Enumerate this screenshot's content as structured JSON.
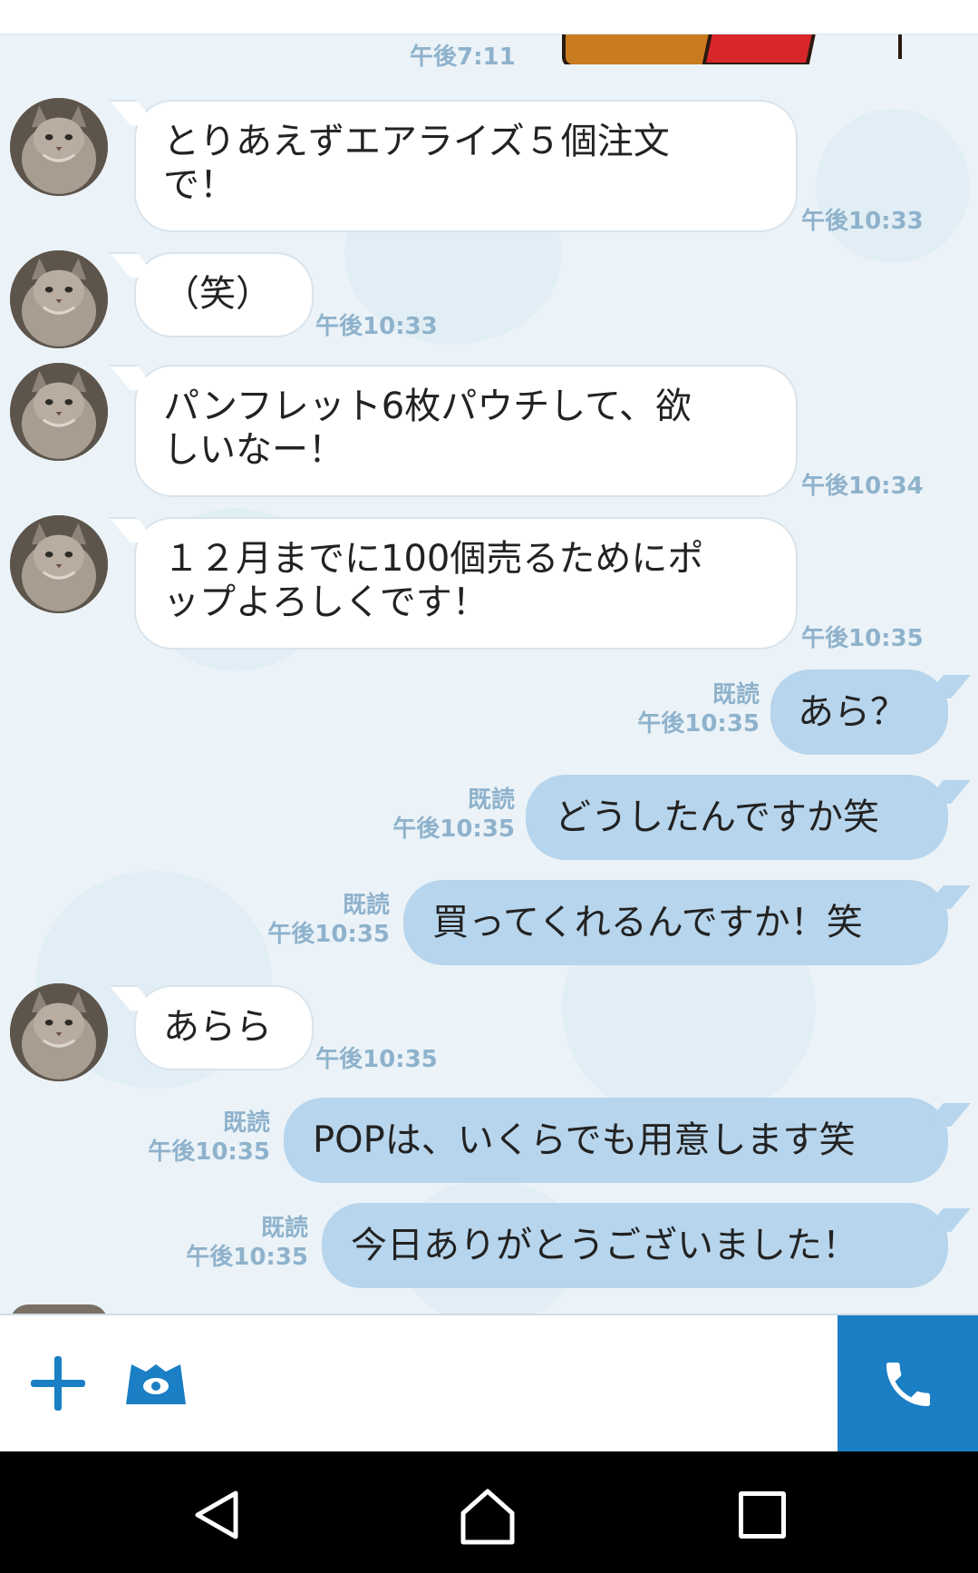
{
  "colors": {
    "accent": "#1a7fc4",
    "bubble_out": "#b7d5ec",
    "bubble_in": "#ffffff",
    "meta_text": "#8fb2cc"
  },
  "chat": {
    "top_time": "午後7:11",
    "messages": [
      {
        "dir": "in",
        "text_lines": [
          "とりあえずエアライズ５個注文",
          "で！"
        ],
        "time": "午後10:33"
      },
      {
        "dir": "in",
        "text_lines": [
          "（笑）"
        ],
        "time": "午後10:33"
      },
      {
        "dir": "in",
        "text_lines": [
          "パンフレット6枚パウチして、欲",
          "しいなー！"
        ],
        "time": "午後10:34"
      },
      {
        "dir": "in",
        "text_lines": [
          "１２月までに100個売るためにポ",
          "ップよろしくです！"
        ],
        "time": "午後10:35"
      },
      {
        "dir": "out",
        "text": "あら？",
        "read": "既読",
        "time": "午後10:35"
      },
      {
        "dir": "out",
        "text": "どうしたんですか笑",
        "read": "既読",
        "time": "午後10:35"
      },
      {
        "dir": "out",
        "text": "買ってくれるんですか！笑",
        "read": "既読",
        "time": "午後10:35"
      },
      {
        "dir": "in",
        "text_lines": [
          "あらら"
        ],
        "time": "午後10:35"
      },
      {
        "dir": "out",
        "text": "POPは、いくらでも用意します笑",
        "read": "既読",
        "time": "午後10:35"
      },
      {
        "dir": "out",
        "text": "今日ありがとうございました！",
        "read": "既読",
        "time": "午後10:35"
      }
    ]
  },
  "input_bar": {
    "plus_icon": "plus-icon",
    "sticker_icon": "monster-eye-sticker-icon",
    "call_icon": "phone-icon",
    "text_value": ""
  },
  "system_nav": {
    "back_icon": "back-triangle-icon",
    "home_icon": "home-icon",
    "recents_icon": "recents-square-icon"
  }
}
